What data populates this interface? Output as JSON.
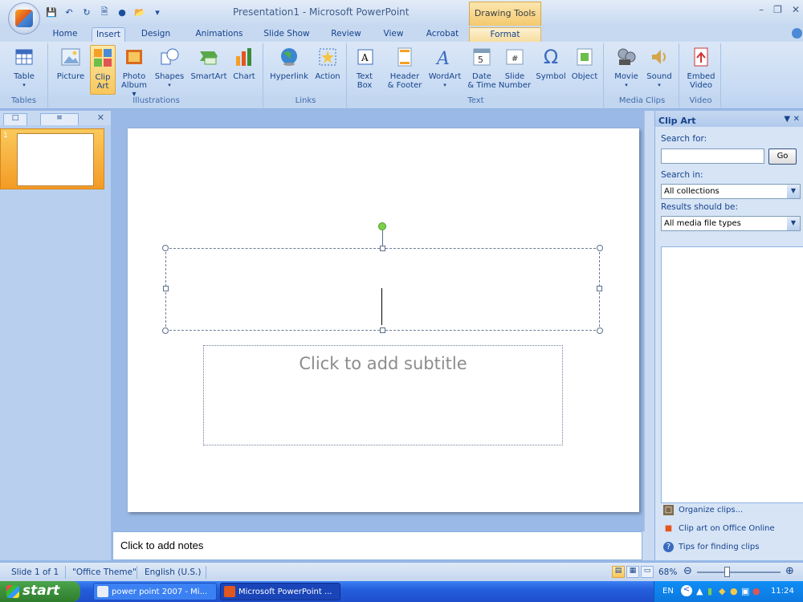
{
  "titlebar": {
    "title": "Presentation1 - Microsoft PowerPoint",
    "contextual_tab_title": "Drawing Tools"
  },
  "tabs": [
    "Home",
    "Insert",
    "Design",
    "Animations",
    "Slide Show",
    "Review",
    "View",
    "Acrobat",
    "Format"
  ],
  "active_tab": "Insert",
  "ribbon": {
    "groups": {
      "tables": "Tables",
      "illustrations": "Illustrations",
      "links": "Links",
      "text": "Text",
      "media": "Media Clips",
      "video": "Video"
    },
    "buttons": {
      "table": "Table",
      "picture": "Picture",
      "clip_art_1": "Clip",
      "clip_art_2": "Art",
      "photo_album_1": "Photo",
      "photo_album_2": "Album",
      "shapes": "Shapes",
      "smartart": "SmartArt",
      "chart": "Chart",
      "hyperlink": "Hyperlink",
      "action": "Action",
      "text_box_1": "Text",
      "text_box_2": "Box",
      "header_footer_1": "Header",
      "header_footer_2": "& Footer",
      "wordart": "WordArt",
      "date_time_1": "Date",
      "date_time_2": "& Time",
      "slide_number_1": "Slide",
      "slide_number_2": "Number",
      "symbol": "Symbol",
      "object": "Object",
      "movie": "Movie",
      "sound": "Sound",
      "embed_video_1": "Embed",
      "embed_video_2": "Video"
    }
  },
  "slides_pane": {
    "thumbnail_number": "1"
  },
  "slide": {
    "subtitle_placeholder": "Click to add subtitle"
  },
  "notes": {
    "placeholder": "Click to add notes"
  },
  "clip_art_pane": {
    "title": "Clip Art",
    "search_for_label": "Search for:",
    "search_value": "",
    "go_label": "Go",
    "search_in_label": "Search in:",
    "search_in_value": "All collections",
    "results_label": "Results should be:",
    "results_value": "All media file types",
    "links": [
      "Organize clips...",
      "Clip art on Office Online",
      "Tips for finding clips"
    ]
  },
  "statusbar": {
    "slide_info": "Slide 1 of 1",
    "theme": "\"Office Theme\"",
    "language": "English (U.S.)",
    "zoom": "68%"
  },
  "taskbar": {
    "start": "start",
    "tasks": [
      "power point 2007 - Mi...",
      "Microsoft PowerPoint ..."
    ],
    "language": "EN",
    "clock": "11:24"
  },
  "colors": {
    "ribbon_bg": "#dbe7f7",
    "accent_selected": "#f8c75a",
    "taskbar": "#245edc",
    "start_green": "#3c8f3c"
  }
}
